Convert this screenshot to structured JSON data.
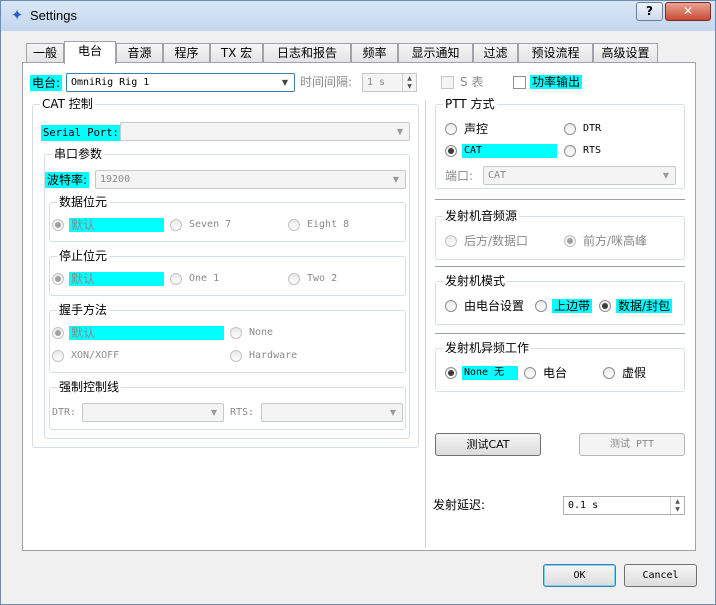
{
  "window": {
    "title": "Settings",
    "help_label": "?",
    "close_label": "✕"
  },
  "tabs": [
    {
      "label": "一般",
      "active": false
    },
    {
      "label": "电台",
      "active": true
    },
    {
      "label": "音源",
      "active": false
    },
    {
      "label": "程序",
      "active": false
    },
    {
      "label": "TX 宏",
      "active": false
    },
    {
      "label": "日志和报告",
      "active": false
    },
    {
      "label": "频率",
      "active": false
    },
    {
      "label": "显示通知",
      "active": false
    },
    {
      "label": "过滤",
      "active": false
    },
    {
      "label": "预设流程",
      "active": false
    },
    {
      "label": "高级设置",
      "active": false
    }
  ],
  "radio": {
    "label": "电台:",
    "selected": "OmniRig Rig 1"
  },
  "poll": {
    "label": "时间间隔:",
    "value": "1 s"
  },
  "s_meter": {
    "label": "S 表",
    "checked": false
  },
  "power_output": {
    "label": "功率输出",
    "checked": false
  },
  "cat": {
    "title": "CAT 控制",
    "serial_port": {
      "label": "Serial Port:",
      "value": ""
    },
    "serial_params_title": "串口参数",
    "baud": {
      "label": "波特率:",
      "value": "19200"
    },
    "data_bits": {
      "title": "数据位元",
      "options": [
        {
          "label": "默认",
          "selected": true
        },
        {
          "label": "Seven 7",
          "selected": false
        },
        {
          "label": "Eight 8",
          "selected": false
        }
      ]
    },
    "stop_bits": {
      "title": "停止位元",
      "options": [
        {
          "label": "默认",
          "selected": true
        },
        {
          "label": "One 1",
          "selected": false
        },
        {
          "label": "Two 2",
          "selected": false
        }
      ]
    },
    "handshake": {
      "title": "握手方法",
      "options": [
        {
          "label": "默认",
          "selected": true
        },
        {
          "label": "None",
          "selected": false
        },
        {
          "label": "XON/XOFF",
          "selected": false
        },
        {
          "label": "Hardware",
          "selected": false
        }
      ]
    },
    "force_lines": {
      "title": "强制控制线",
      "dtr_label": "DTR:",
      "dtr_value": "",
      "rts_label": "RTS:",
      "rts_value": ""
    }
  },
  "ptt": {
    "title": "PTT 方式",
    "options": [
      {
        "label": "声控",
        "selected": false
      },
      {
        "label": "DTR",
        "selected": false
      },
      {
        "label": "CAT",
        "selected": true
      },
      {
        "label": "RTS",
        "selected": false
      }
    ],
    "port_label": "端口:",
    "port_value": "CAT"
  },
  "tx_audio": {
    "title": "发射机音频源",
    "options": [
      {
        "label": "后方/数据口",
        "selected": false
      },
      {
        "label": "前方/咪高峰",
        "selected": true
      }
    ]
  },
  "tx_mode": {
    "title": "发射机模式",
    "options": [
      {
        "label": "由电台设置",
        "selected": false
      },
      {
        "label": "上边带",
        "selected": false
      },
      {
        "label": "数据/封包",
        "selected": true
      }
    ]
  },
  "split": {
    "title": "发射机异频工作",
    "options": [
      {
        "label": "None 无",
        "selected": true
      },
      {
        "label": "电台",
        "selected": false
      },
      {
        "label": "虚假",
        "selected": false
      }
    ]
  },
  "buttons": {
    "test_cat": "测试CAT",
    "test_ptt": "测试 PTT",
    "ok": "OK",
    "cancel": "Cancel"
  },
  "tx_delay": {
    "label": "发射延迟:",
    "value": "0.1 s"
  },
  "colors": {
    "highlight": "#00ffff",
    "accent_border": "#3c7fb1"
  }
}
